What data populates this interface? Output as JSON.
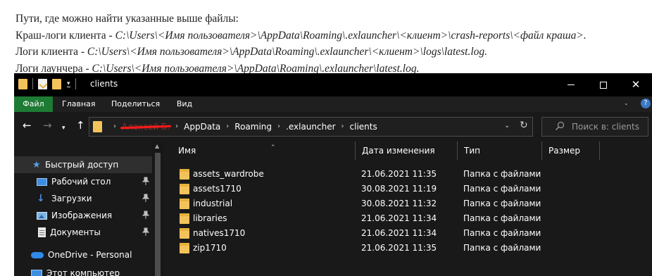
{
  "doc": {
    "line1": "Пути, где можно найти указанные выше файлы:",
    "crash": {
      "label": "Краш-логи клиента - ",
      "path": "C:\\Users\\<Имя пользователя>\\AppData\\Roaming\\.exlauncher\\<клиент>\\crash-reports\\<файл краша>."
    },
    "client": {
      "label": "Логи клиента - ",
      "path": "C:\\Users\\<Имя пользователя>\\AppData\\Roaming\\.exlauncher\\<клиент>\\logs\\latest.log."
    },
    "launcher": {
      "label": "Логи лаунчера - ",
      "path": "C:\\Users\\<Имя пользователя>\\AppData\\Roaming\\.exlauncher\\latest.log."
    }
  },
  "window": {
    "title": "clients",
    "controls": {
      "minimize": "–",
      "close": "✕"
    }
  },
  "ribbon": {
    "tabs": {
      "file": "Файл",
      "home": "Главная",
      "share": "Поделиться",
      "view": "Вид"
    },
    "help": "?"
  },
  "address": {
    "crumbs": {
      "user": "Алексей Б.",
      "appdata": "AppData",
      "roaming": "Roaming",
      "exlauncher": ".exlauncher",
      "clients": "clients"
    }
  },
  "search": {
    "placeholder": "Поиск в: clients"
  },
  "nav": {
    "quick_access": "Быстрый доступ",
    "desktop": "Рабочий стол",
    "downloads": "Загрузки",
    "pictures": "Изображения",
    "documents": "Документы",
    "onedrive": "OneDrive - Personal",
    "this_pc": "Этот компьютер"
  },
  "columns": {
    "name": "Имя",
    "date": "Дата изменения",
    "type": "Тип",
    "size": "Размер"
  },
  "files": [
    {
      "name": "assets_wardrobe",
      "date": "21.06.2021 11:35",
      "type": "Папка с файлами"
    },
    {
      "name": "assets1710",
      "date": "30.08.2021 11:19",
      "type": "Папка с файлами"
    },
    {
      "name": "industrial",
      "date": "30.08.2021 11:32",
      "type": "Папка с файлами"
    },
    {
      "name": "libraries",
      "date": "21.06.2021 11:34",
      "type": "Папка с файлами"
    },
    {
      "name": "natives1710",
      "date": "21.06.2021 11:34",
      "type": "Папка с файлами"
    },
    {
      "name": "zip1710",
      "date": "21.06.2021 11:35",
      "type": "Папка с файлами"
    }
  ],
  "colors": {
    "accent_file_tab": "#1e7b34",
    "folder": "#f3c35b",
    "background": "#191919"
  }
}
